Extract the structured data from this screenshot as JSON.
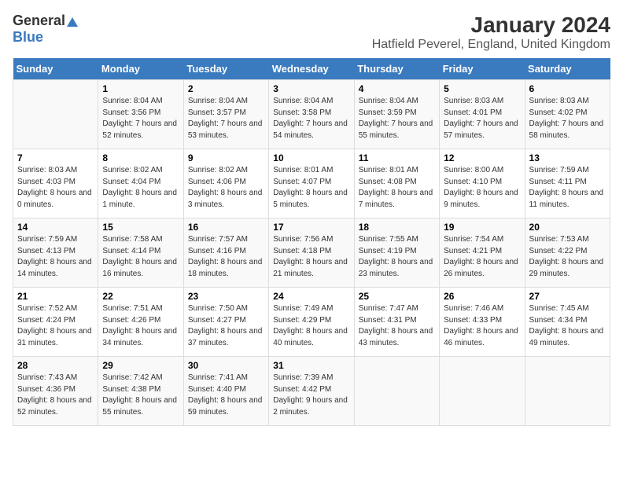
{
  "logo": {
    "general": "General",
    "blue": "Blue"
  },
  "header": {
    "month": "January 2024",
    "location": "Hatfield Peverel, England, United Kingdom"
  },
  "weekdays": [
    "Sunday",
    "Monday",
    "Tuesday",
    "Wednesday",
    "Thursday",
    "Friday",
    "Saturday"
  ],
  "weeks": [
    [
      {
        "day": "",
        "sunrise": "",
        "sunset": "",
        "daylight": ""
      },
      {
        "day": "1",
        "sunrise": "Sunrise: 8:04 AM",
        "sunset": "Sunset: 3:56 PM",
        "daylight": "Daylight: 7 hours and 52 minutes."
      },
      {
        "day": "2",
        "sunrise": "Sunrise: 8:04 AM",
        "sunset": "Sunset: 3:57 PM",
        "daylight": "Daylight: 7 hours and 53 minutes."
      },
      {
        "day": "3",
        "sunrise": "Sunrise: 8:04 AM",
        "sunset": "Sunset: 3:58 PM",
        "daylight": "Daylight: 7 hours and 54 minutes."
      },
      {
        "day": "4",
        "sunrise": "Sunrise: 8:04 AM",
        "sunset": "Sunset: 3:59 PM",
        "daylight": "Daylight: 7 hours and 55 minutes."
      },
      {
        "day": "5",
        "sunrise": "Sunrise: 8:03 AM",
        "sunset": "Sunset: 4:01 PM",
        "daylight": "Daylight: 7 hours and 57 minutes."
      },
      {
        "day": "6",
        "sunrise": "Sunrise: 8:03 AM",
        "sunset": "Sunset: 4:02 PM",
        "daylight": "Daylight: 7 hours and 58 minutes."
      }
    ],
    [
      {
        "day": "7",
        "sunrise": "Sunrise: 8:03 AM",
        "sunset": "Sunset: 4:03 PM",
        "daylight": "Daylight: 8 hours and 0 minutes."
      },
      {
        "day": "8",
        "sunrise": "Sunrise: 8:02 AM",
        "sunset": "Sunset: 4:04 PM",
        "daylight": "Daylight: 8 hours and 1 minute."
      },
      {
        "day": "9",
        "sunrise": "Sunrise: 8:02 AM",
        "sunset": "Sunset: 4:06 PM",
        "daylight": "Daylight: 8 hours and 3 minutes."
      },
      {
        "day": "10",
        "sunrise": "Sunrise: 8:01 AM",
        "sunset": "Sunset: 4:07 PM",
        "daylight": "Daylight: 8 hours and 5 minutes."
      },
      {
        "day": "11",
        "sunrise": "Sunrise: 8:01 AM",
        "sunset": "Sunset: 4:08 PM",
        "daylight": "Daylight: 8 hours and 7 minutes."
      },
      {
        "day": "12",
        "sunrise": "Sunrise: 8:00 AM",
        "sunset": "Sunset: 4:10 PM",
        "daylight": "Daylight: 8 hours and 9 minutes."
      },
      {
        "day": "13",
        "sunrise": "Sunrise: 7:59 AM",
        "sunset": "Sunset: 4:11 PM",
        "daylight": "Daylight: 8 hours and 11 minutes."
      }
    ],
    [
      {
        "day": "14",
        "sunrise": "Sunrise: 7:59 AM",
        "sunset": "Sunset: 4:13 PM",
        "daylight": "Daylight: 8 hours and 14 minutes."
      },
      {
        "day": "15",
        "sunrise": "Sunrise: 7:58 AM",
        "sunset": "Sunset: 4:14 PM",
        "daylight": "Daylight: 8 hours and 16 minutes."
      },
      {
        "day": "16",
        "sunrise": "Sunrise: 7:57 AM",
        "sunset": "Sunset: 4:16 PM",
        "daylight": "Daylight: 8 hours and 18 minutes."
      },
      {
        "day": "17",
        "sunrise": "Sunrise: 7:56 AM",
        "sunset": "Sunset: 4:18 PM",
        "daylight": "Daylight: 8 hours and 21 minutes."
      },
      {
        "day": "18",
        "sunrise": "Sunrise: 7:55 AM",
        "sunset": "Sunset: 4:19 PM",
        "daylight": "Daylight: 8 hours and 23 minutes."
      },
      {
        "day": "19",
        "sunrise": "Sunrise: 7:54 AM",
        "sunset": "Sunset: 4:21 PM",
        "daylight": "Daylight: 8 hours and 26 minutes."
      },
      {
        "day": "20",
        "sunrise": "Sunrise: 7:53 AM",
        "sunset": "Sunset: 4:22 PM",
        "daylight": "Daylight: 8 hours and 29 minutes."
      }
    ],
    [
      {
        "day": "21",
        "sunrise": "Sunrise: 7:52 AM",
        "sunset": "Sunset: 4:24 PM",
        "daylight": "Daylight: 8 hours and 31 minutes."
      },
      {
        "day": "22",
        "sunrise": "Sunrise: 7:51 AM",
        "sunset": "Sunset: 4:26 PM",
        "daylight": "Daylight: 8 hours and 34 minutes."
      },
      {
        "day": "23",
        "sunrise": "Sunrise: 7:50 AM",
        "sunset": "Sunset: 4:27 PM",
        "daylight": "Daylight: 8 hours and 37 minutes."
      },
      {
        "day": "24",
        "sunrise": "Sunrise: 7:49 AM",
        "sunset": "Sunset: 4:29 PM",
        "daylight": "Daylight: 8 hours and 40 minutes."
      },
      {
        "day": "25",
        "sunrise": "Sunrise: 7:47 AM",
        "sunset": "Sunset: 4:31 PM",
        "daylight": "Daylight: 8 hours and 43 minutes."
      },
      {
        "day": "26",
        "sunrise": "Sunrise: 7:46 AM",
        "sunset": "Sunset: 4:33 PM",
        "daylight": "Daylight: 8 hours and 46 minutes."
      },
      {
        "day": "27",
        "sunrise": "Sunrise: 7:45 AM",
        "sunset": "Sunset: 4:34 PM",
        "daylight": "Daylight: 8 hours and 49 minutes."
      }
    ],
    [
      {
        "day": "28",
        "sunrise": "Sunrise: 7:43 AM",
        "sunset": "Sunset: 4:36 PM",
        "daylight": "Daylight: 8 hours and 52 minutes."
      },
      {
        "day": "29",
        "sunrise": "Sunrise: 7:42 AM",
        "sunset": "Sunset: 4:38 PM",
        "daylight": "Daylight: 8 hours and 55 minutes."
      },
      {
        "day": "30",
        "sunrise": "Sunrise: 7:41 AM",
        "sunset": "Sunset: 4:40 PM",
        "daylight": "Daylight: 8 hours and 59 minutes."
      },
      {
        "day": "31",
        "sunrise": "Sunrise: 7:39 AM",
        "sunset": "Sunset: 4:42 PM",
        "daylight": "Daylight: 9 hours and 2 minutes."
      },
      {
        "day": "",
        "sunrise": "",
        "sunset": "",
        "daylight": ""
      },
      {
        "day": "",
        "sunrise": "",
        "sunset": "",
        "daylight": ""
      },
      {
        "day": "",
        "sunrise": "",
        "sunset": "",
        "daylight": ""
      }
    ]
  ]
}
